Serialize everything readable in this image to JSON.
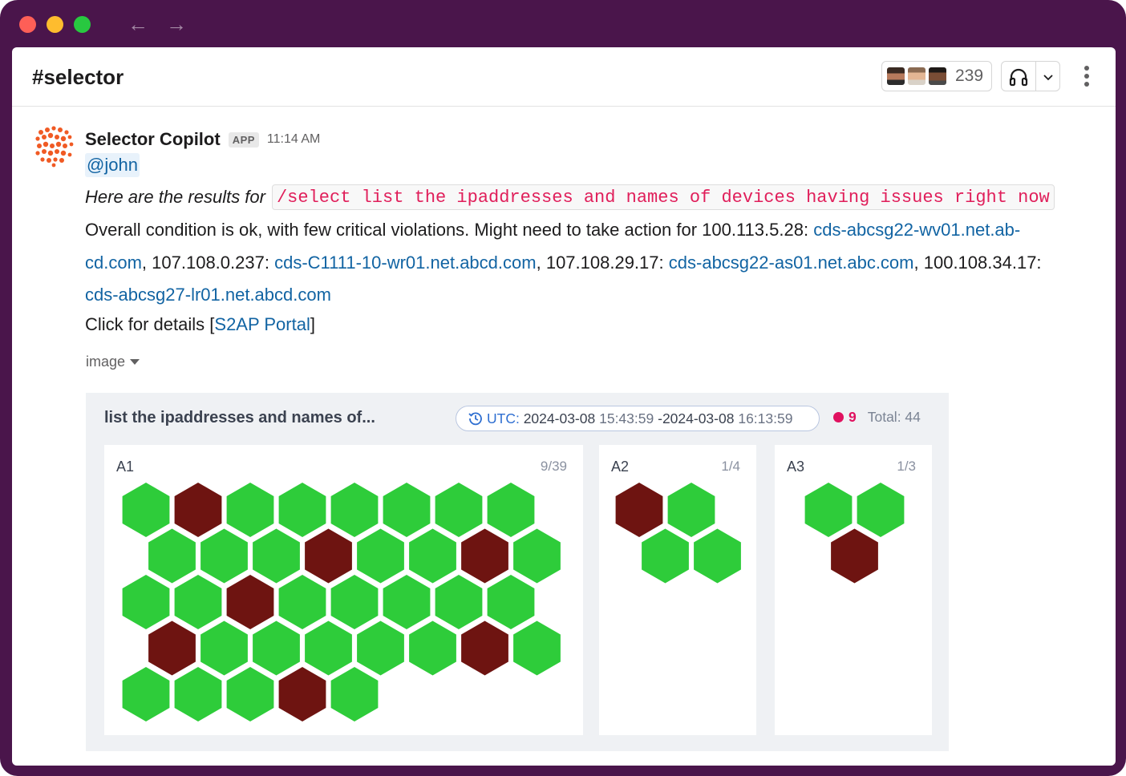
{
  "header": {
    "channel": "#selector",
    "member_count": "239"
  },
  "message": {
    "sender": "Selector Copilot",
    "badge": "APP",
    "time": "11:14 AM",
    "mention": "@john",
    "intro": "Here are the results for",
    "command": "/select list the ipaddresses and names of devices having issues right now",
    "summary": "Overall condition is ok, with few critical violations. Might need to take action for 100.113.5.28:",
    "devices": [
      {
        "ip": "100.113.5.28:",
        "host": "cds-abcsg22-wv01.net.ab-cd.com"
      },
      {
        "ip": "107.108.0.237:",
        "host": "cds-C1111-10-wr01.net.abcd.com"
      },
      {
        "ip": "107.108.29.17:",
        "host": "cds-abcsg22-as01.net.abc.com"
      },
      {
        "ip": "100.108.34.17:",
        "host": "cds-abcsg27-lr01.net.abcd.com"
      }
    ],
    "details_prefix": "Click for details [",
    "details_link": "S2AP Portal",
    "details_suffix": "]",
    "attachment_label": "image"
  },
  "dashboard": {
    "title": "list the ipaddresses and names of...",
    "utc_label": "UTC:",
    "start_date": "2024-03-08",
    "start_time": "15:43:59",
    "range_sep": "-",
    "end_date": "2024-03-08",
    "end_time": "16:13:59",
    "critical_count": "9",
    "total": "Total: 44",
    "colors": {
      "ok": "#2ecc3a",
      "critical": "#6e1411"
    },
    "panels": [
      {
        "label": "A1",
        "count": "9/39",
        "rows": [
          [
            "ok",
            "critical",
            "ok",
            "ok",
            "ok",
            "ok",
            "ok",
            "ok"
          ],
          [
            "ok",
            "ok",
            "ok",
            "critical",
            "ok",
            "ok",
            "critical",
            "ok"
          ],
          [
            "ok",
            "ok",
            "critical",
            "ok",
            "ok",
            "ok",
            "ok",
            "ok"
          ],
          [
            "critical",
            "ok",
            "ok",
            "ok",
            "ok",
            "ok",
            "critical",
            "ok"
          ],
          [
            "ok",
            "ok",
            "ok",
            "critical",
            "ok"
          ]
        ]
      },
      {
        "label": "A2",
        "count": "1/4",
        "rows": [
          [
            "critical",
            "ok"
          ],
          [
            "ok",
            "ok"
          ]
        ]
      },
      {
        "label": "A3",
        "count": "1/3",
        "rows": [
          [
            "ok",
            "ok"
          ],
          [
            "critical"
          ]
        ]
      }
    ]
  }
}
